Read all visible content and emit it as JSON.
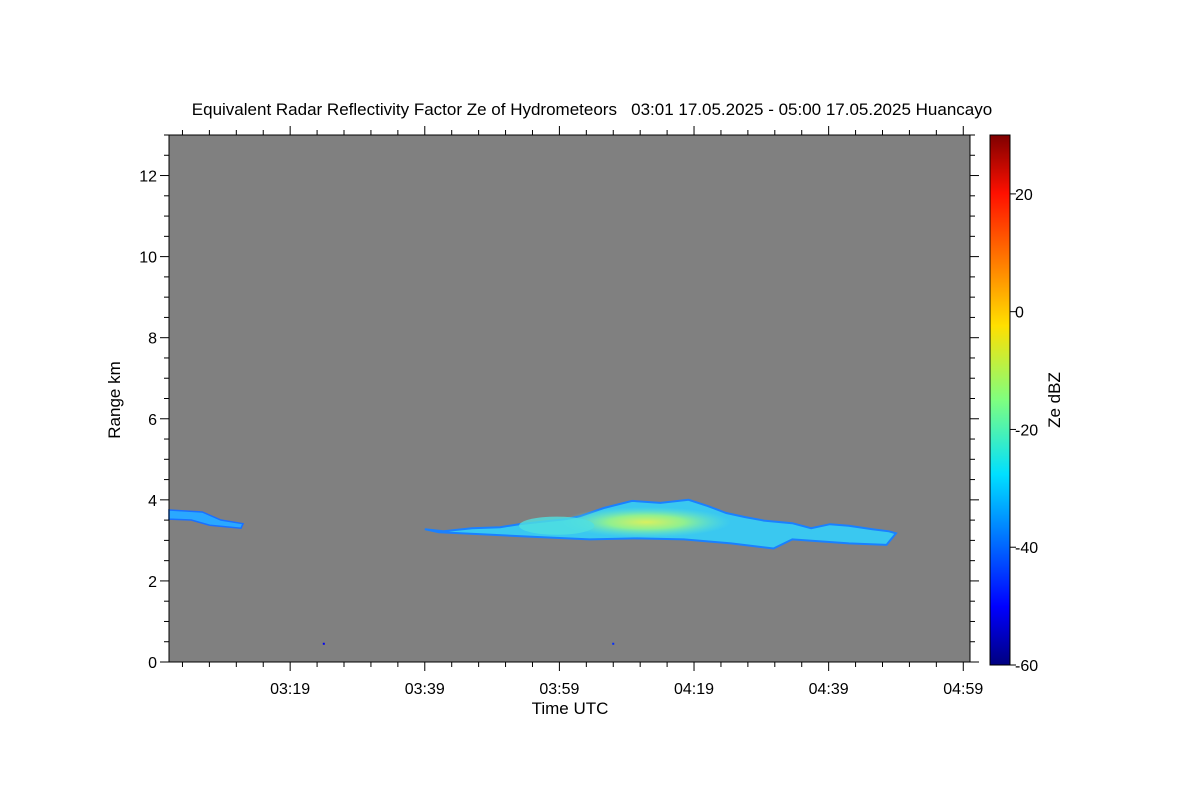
{
  "chart_data": {
    "type": "heatmap",
    "title": "Equivalent Radar Reflectivity Factor Ze of Hydrometeors   03:01 17.05.2025 - 05:00 17.05.2025 Huancayo",
    "xlabel": "Time UTC",
    "ylabel": "Range km",
    "x_tick_labels": [
      "03:19",
      "03:39",
      "03:59",
      "04:19",
      "04:39",
      "04:59"
    ],
    "xlim": [
      "03:01",
      "05:00"
    ],
    "ylim": [
      0,
      13
    ],
    "y_ticks": [
      0,
      2,
      4,
      6,
      8,
      10,
      12
    ],
    "background_color": "#808080",
    "colorbar": {
      "label": "Ze dBZ",
      "range": [
        -60,
        30
      ],
      "ticks": [
        -60,
        -40,
        -20,
        0,
        20
      ],
      "colormap": "jet"
    },
    "echoes": [
      {
        "name": "echo-1",
        "time_start": "03:01",
        "time_end": "03:12",
        "base_km": 3.3,
        "top_km": 3.75,
        "ze_dbz_max": -30
      },
      {
        "name": "echo-2",
        "time_start": "03:39",
        "time_end": "04:49",
        "base_km": 2.8,
        "top_km": 4.05,
        "ze_dbz_max": -7
      }
    ],
    "points": [
      {
        "time": "03:24",
        "range_km": 0.45,
        "ze_dbz": -50
      },
      {
        "time": "04:07",
        "range_km": 0.45,
        "ze_dbz": -45
      }
    ]
  }
}
